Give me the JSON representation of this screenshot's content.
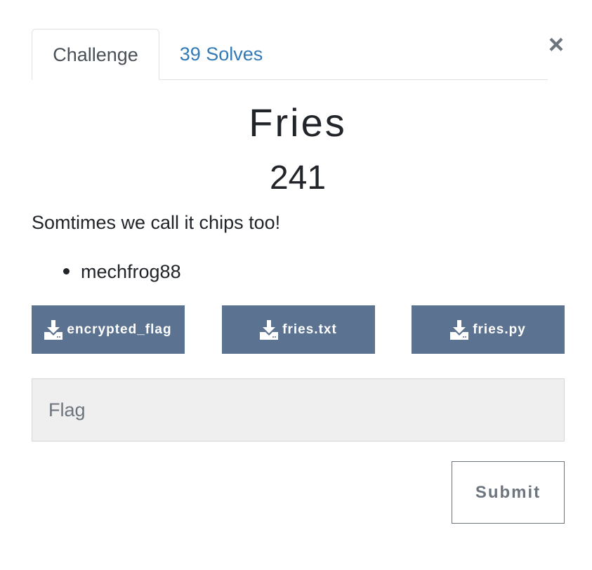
{
  "tabs": {
    "challenge": "Challenge",
    "solves": "39 Solves"
  },
  "close": {
    "symbol": "×"
  },
  "challenge": {
    "name": "Fries",
    "points": "241",
    "description": "Somtimes we call it chips too!",
    "authors": [
      "mechfrog88"
    ]
  },
  "files": [
    {
      "label": "encrypted_flag",
      "icon": "download-icon"
    },
    {
      "label": "fries.txt",
      "icon": "download-icon"
    },
    {
      "label": "fries.py",
      "icon": "download-icon"
    }
  ],
  "form": {
    "flag_placeholder": "Flag",
    "flag_value": "",
    "submit_label": "Submit"
  },
  "colors": {
    "file_button_bg": "#5b7290",
    "tab_link": "#337ab7",
    "input_bg": "#efefef"
  }
}
